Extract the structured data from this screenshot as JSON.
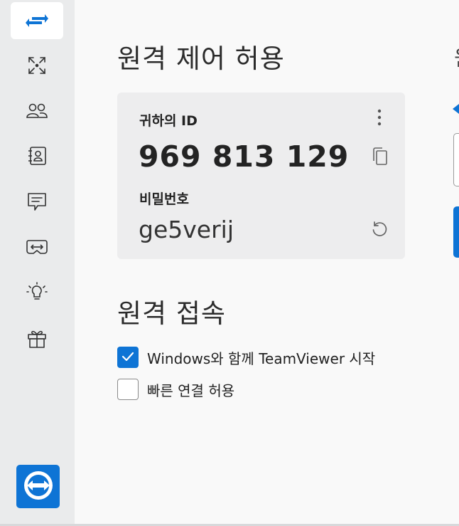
{
  "sidebar": {
    "items": [
      {
        "name": "remote-control-icon",
        "active": true
      },
      {
        "name": "meeting-icon",
        "active": false
      },
      {
        "name": "contacts-icon",
        "active": false
      },
      {
        "name": "address-book-icon",
        "active": false
      },
      {
        "name": "chat-icon",
        "active": false
      },
      {
        "name": "augmented-reality-icon",
        "active": false
      },
      {
        "name": "tips-icon",
        "active": false
      },
      {
        "name": "whats-new-icon",
        "active": false
      }
    ],
    "logo": "teamviewer-logo-icon"
  },
  "allow_remote": {
    "title": "원격 제어 허용",
    "id_label": "귀하의 ID",
    "id_value": "969 813 129",
    "password_label": "비밀번호",
    "password_value": "ge5verij",
    "icons": [
      "more-options-icon",
      "copy-icon",
      "refresh-password-icon"
    ]
  },
  "remote_access": {
    "title": "원격 접속",
    "options": [
      {
        "label": "Windows와 함께 TeamViewer 시작",
        "checked": true
      },
      {
        "label": "빠른 연결 허용",
        "checked": false
      }
    ]
  },
  "right_panel_partial": {
    "heading_fragment": "원"
  },
  "colors": {
    "accent": "#0e74d5",
    "sidebar_bg": "#eaebec",
    "card_bg": "#ededee",
    "main_bg": "#f9f9f9"
  }
}
